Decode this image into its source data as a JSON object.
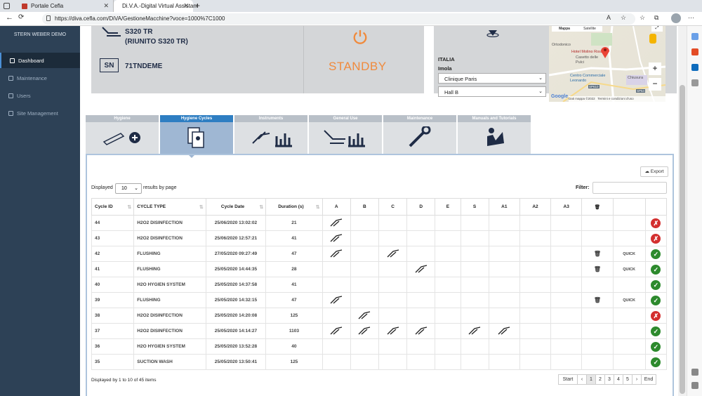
{
  "browser": {
    "tabs": [
      {
        "label": "Portale Cefla"
      },
      {
        "label": "Di.V.A.-Digital Virtual Assistant"
      }
    ],
    "url": "https://diva.cefla.com/DiVA/GestioneMacchine?voce=1000%7C1000"
  },
  "sidebar": {
    "brand": "STERN WEBER DEMO",
    "items": [
      {
        "label": "Dashboard",
        "active": true
      },
      {
        "label": "Maintenance",
        "active": false
      },
      {
        "label": "Users",
        "active": false
      },
      {
        "label": "Site Management",
        "active": false
      }
    ]
  },
  "device": {
    "model_line1": "S320 TR",
    "model_line2": "(RIUNITO S320 TR)",
    "sn_badge": "SN",
    "serial": "71TNDEME",
    "status": "STANDBY",
    "status_color": "#f08a3c"
  },
  "location": {
    "country": "ITALIA",
    "city": "Imola",
    "clinic": "Clinique Paris",
    "hall": "Hall B",
    "map_labels": {
      "place1": "Ortodonico",
      "place2": "Hotel Molino Rosso",
      "place3": "Casetto delle Pulci",
      "place4": "Centro Commerciale Leonardo",
      "place5": "Chiusura",
      "road1": "SP610",
      "road2": "SP54",
      "tab1": "Mappa",
      "tab2": "Satellite",
      "google": "Google",
      "credits": "Dati mappa ©2022",
      "terms": "Termini e condizioni d'uso"
    }
  },
  "category_tabs": [
    {
      "label": "Hygiene",
      "selected": false
    },
    {
      "label": "Hygiene Cycles",
      "selected": true
    },
    {
      "label": "Instruments",
      "selected": false
    },
    {
      "label": "General Use",
      "selected": false
    },
    {
      "label": "Maintenance",
      "selected": false
    },
    {
      "label": "Manuals and Tutorials",
      "selected": false
    }
  ],
  "table_controls": {
    "export_label": "Export",
    "displayed_label": "Displayed",
    "page_length": "10",
    "results_label": "results by page",
    "filter_label": "Filter:"
  },
  "table": {
    "headers": [
      "Cycle ID",
      "CYCLE TYPE",
      "Cycle Date",
      "Duration (s)",
      "A",
      "B",
      "C",
      "D",
      "E",
      "S",
      "A1",
      "A2",
      "A3",
      "",
      "",
      ""
    ],
    "rows": [
      {
        "id": "44",
        "type": "H2O2 DISINFECTION",
        "date": "25/06/2020 13:02:02",
        "duration": "21",
        "inst": [
          "A"
        ],
        "trash": false,
        "quick": "",
        "ok": false
      },
      {
        "id": "43",
        "type": "H2O2 DISINFECTION",
        "date": "25/06/2020 12:57:21",
        "duration": "41",
        "inst": [
          "A"
        ],
        "trash": false,
        "quick": "",
        "ok": false
      },
      {
        "id": "42",
        "type": "FLUSHING",
        "date": "27/05/2020 09:27:49",
        "duration": "47",
        "inst": [
          "A",
          "C"
        ],
        "trash": true,
        "quick": "QUICK",
        "ok": true
      },
      {
        "id": "41",
        "type": "FLUSHING",
        "date": "25/05/2020 14:44:35",
        "duration": "28",
        "inst": [
          "D"
        ],
        "trash": true,
        "quick": "QUICK",
        "ok": true
      },
      {
        "id": "40",
        "type": "H2O HYGIEN SYSTEM",
        "date": "25/05/2020 14:37:58",
        "duration": "41",
        "inst": [],
        "trash": false,
        "quick": "",
        "ok": true
      },
      {
        "id": "39",
        "type": "FLUSHING",
        "date": "25/05/2020 14:32:15",
        "duration": "47",
        "inst": [
          "A"
        ],
        "trash": true,
        "quick": "QUICK",
        "ok": true
      },
      {
        "id": "38",
        "type": "H2O2 DISINFECTION",
        "date": "25/05/2020 14:20:08",
        "duration": "125",
        "inst": [
          "B"
        ],
        "trash": false,
        "quick": "",
        "ok": false
      },
      {
        "id": "37",
        "type": "H2O2 DISINFECTION",
        "date": "25/05/2020 14:14:27",
        "duration": "1103",
        "inst": [
          "A",
          "B",
          "C",
          "D",
          "S",
          "A1"
        ],
        "trash": false,
        "quick": "",
        "ok": true
      },
      {
        "id": "36",
        "type": "H2O HYGIEN SYSTEM",
        "date": "25/05/2020 13:52:28",
        "duration": "40",
        "inst": [],
        "trash": false,
        "quick": "",
        "ok": true
      },
      {
        "id": "35",
        "type": "SUCTION WASH",
        "date": "25/05/2020 13:50:41",
        "duration": "125",
        "inst": [],
        "trash": false,
        "quick": "",
        "ok": true
      }
    ]
  },
  "pagination": {
    "info": "Displayed by 1 to 10 of 45 items",
    "start": "Start",
    "prev": "‹",
    "pages": [
      "1",
      "2",
      "3",
      "4",
      "5"
    ],
    "next": "›",
    "end": "End",
    "current": "1"
  },
  "colors": {
    "sidebar": "#2d4156",
    "accent": "#2e7ec2",
    "ok": "#2d8a2d",
    "error": "#d32f2f"
  }
}
